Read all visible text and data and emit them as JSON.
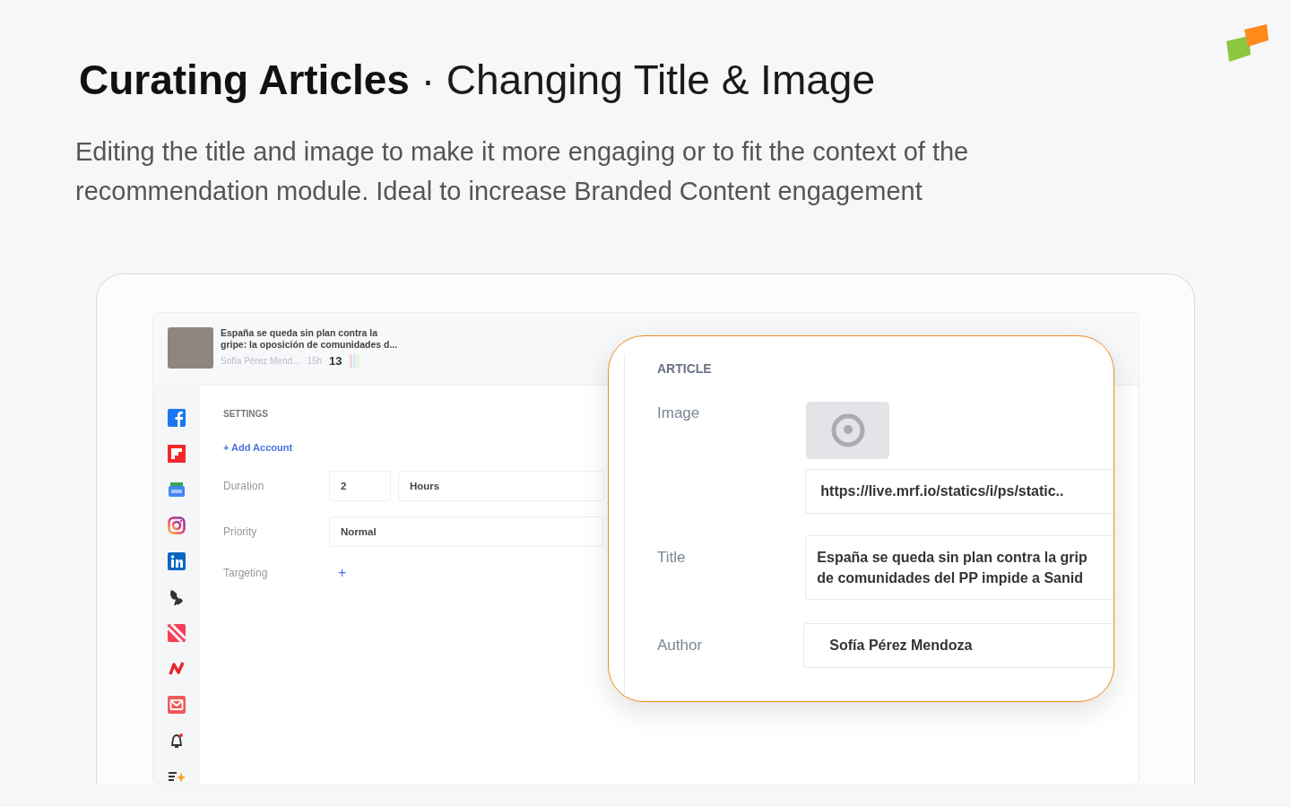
{
  "heading": "**Curating Articles** · Changing Title & Image",
  "description": "Editing the title and image to make it more engaging or to fit the context of the recommendation module. Ideal to increase Branded Content engagement",
  "article": {
    "title_lines": [
      "España se queda sin plan contra la",
      "gripe: la oposición de comunidades d..."
    ],
    "author": "Sofía Pérez Mend...",
    "age": "15h",
    "count": "13"
  },
  "settings": {
    "heading": "SETTINGS",
    "add_account": "+ Add Account",
    "fields": [
      {
        "kind": "duration",
        "label": "Duration",
        "value": "2",
        "unit": "Hours"
      },
      {
        "kind": "select",
        "label": "Priority",
        "value": "Normal"
      },
      {
        "kind": "add",
        "label": "Targeting",
        "value": "+"
      }
    ]
  },
  "article_panel": {
    "heading": "ARTICLE",
    "image_label": "Image",
    "image_url": "https://live.mrf.io/statics/i/ps/static..",
    "title_label": "Title",
    "title_lines": [
      "España se queda sin plan contra la grip",
      "de comunidades del PP impide a Sanid"
    ],
    "author_label": "Author",
    "author": "Sofía Pérez Mendoza"
  }
}
